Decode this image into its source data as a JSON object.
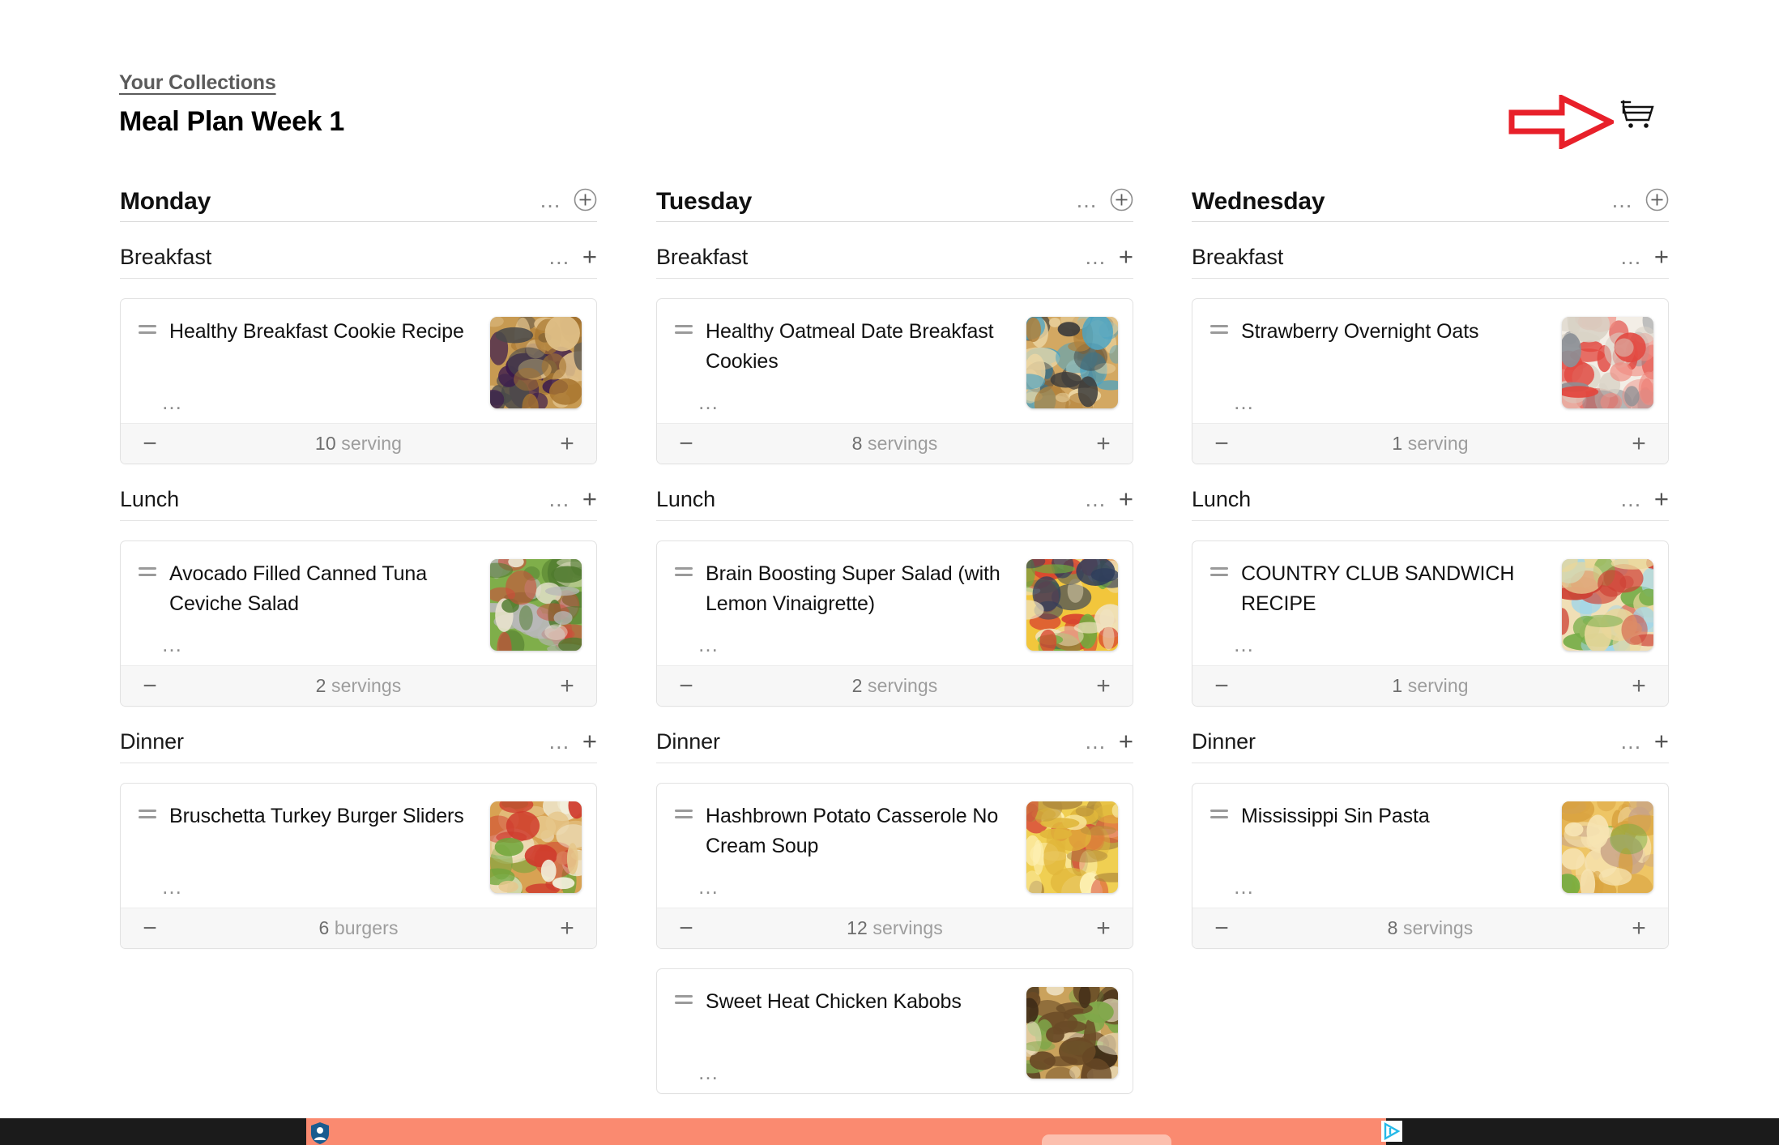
{
  "header": {
    "breadcrumb": "Your Collections",
    "title": "Meal Plan Week 1",
    "cart_icon": "shopping-cart-icon"
  },
  "annotation": {
    "type": "arrow",
    "direction": "right",
    "color": "#e8202a",
    "points_at": "shopping-cart-icon"
  },
  "icons": {
    "more": "…",
    "plus": "+",
    "minus": "−"
  },
  "ad": {
    "shield_icon": "privacy-shield-icon",
    "adchoices_icon": "adchoices-icon",
    "background": "#fa8a70",
    "bar_background": "#1b1b1b"
  },
  "columns": [
    {
      "day": "Monday",
      "meals": [
        {
          "name": "Breakfast",
          "cards": [
            {
              "title": "Healthy Breakfast Cookie Recipe",
              "quantity": "10",
              "unit": "serving",
              "thumb": "oatmeal-cookies-photo"
            }
          ]
        },
        {
          "name": "Lunch",
          "cards": [
            {
              "title": "Avocado Filled Canned Tuna Ceviche Salad",
              "quantity": "2",
              "unit": "servings",
              "thumb": "avocado-tuna-salad-photo"
            }
          ]
        },
        {
          "name": "Dinner",
          "cards": [
            {
              "title": "Bruschetta Turkey Burger Sliders",
              "quantity": "6",
              "unit": "burgers",
              "thumb": "turkey-burger-slider-photo"
            }
          ]
        }
      ]
    },
    {
      "day": "Tuesday",
      "meals": [
        {
          "name": "Breakfast",
          "cards": [
            {
              "title": "Healthy Oatmeal Date Breakfast Cookies",
              "quantity": "8",
              "unit": "servings",
              "thumb": "oatmeal-date-cookies-photo"
            }
          ]
        },
        {
          "name": "Lunch",
          "cards": [
            {
              "title": "Brain Boosting Super Salad (with Lemon Vinaigrette)",
              "quantity": "2",
              "unit": "servings",
              "thumb": "fruit-super-salad-photo"
            }
          ]
        },
        {
          "name": "Dinner",
          "cards": [
            {
              "title": "Hashbrown Potato Casserole No Cream Soup",
              "quantity": "12",
              "unit": "servings",
              "thumb": "funeral-potatoes-photo"
            },
            {
              "title": "Sweet Heat Chicken Kabobs",
              "quantity": "",
              "unit": "",
              "thumb": "chicken-kabobs-photo"
            }
          ]
        }
      ]
    },
    {
      "day": "Wednesday",
      "meals": [
        {
          "name": "Breakfast",
          "cards": [
            {
              "title": "Strawberry Overnight Oats",
              "quantity": "1",
              "unit": "serving",
              "thumb": "strawberry-overnight-oats-photo"
            }
          ]
        },
        {
          "name": "Lunch",
          "cards": [
            {
              "title": "COUNTRY CLUB SANDWICH RECIPE",
              "quantity": "1",
              "unit": "serving",
              "thumb": "club-sandwich-photo"
            }
          ]
        },
        {
          "name": "Dinner",
          "cards": [
            {
              "title": "Mississippi Sin Pasta",
              "quantity": "8",
              "unit": "servings",
              "thumb": "mississippi-sin-pasta-photo"
            }
          ]
        }
      ]
    }
  ]
}
